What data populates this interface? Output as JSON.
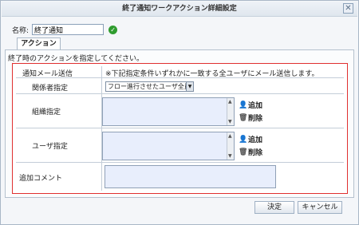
{
  "dialog": {
    "title": "終了通知ワークアクション詳細設定"
  },
  "name_field": {
    "label": "名称:",
    "value": "終了通知"
  },
  "tabs": [
    {
      "label": "アクション"
    }
  ],
  "panel": {
    "description": "終了時のアクションを指定してください。",
    "mail_send_label": "通知メール送信",
    "mail_send_note": "※下記指定条件いずれかに一致する全ユーザにメール送信します。",
    "relation_label": "関係者指定",
    "relation_select_value": "フロー進行させたユーザ全員",
    "org_label": "組織指定",
    "user_label": "ユーザ指定",
    "comment_label": "追加コメント",
    "add_label": "追加",
    "delete_label": "削除"
  },
  "buttons": {
    "ok": "決定",
    "cancel": "キャンセル"
  }
}
